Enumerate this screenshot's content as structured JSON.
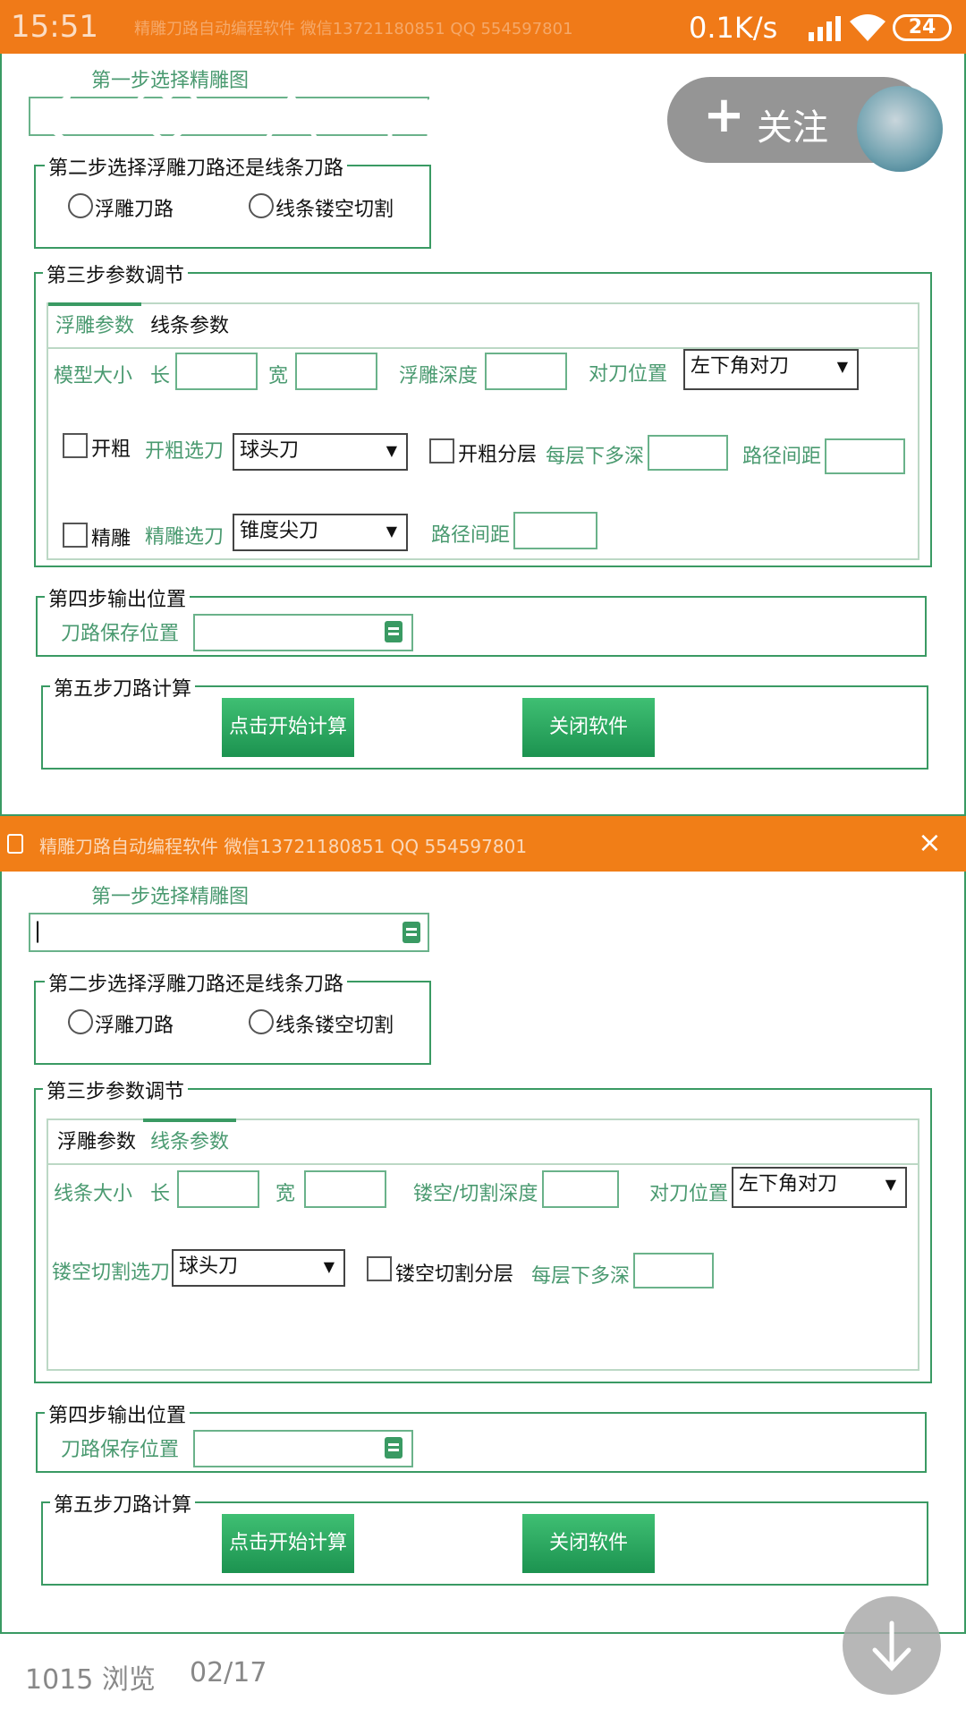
{
  "status": {
    "time": "15:51",
    "net_speed": "0.1K/s",
    "battery": "24",
    "blurred_title": "精雕刀路自动编程软件 微信13721180851 QQ 554597801"
  },
  "overlay": {
    "follow_label": "关注",
    "follow_plus": "+"
  },
  "window1": {
    "step1": "第一步选择精雕图",
    "step2": "第二步选择浮雕刀路还是线条刀路",
    "radio_relief": "浮雕刀路",
    "radio_line": "线条镂空切割",
    "step3": "第三步参数调节",
    "tab_relief": "浮雕参数",
    "tab_line": "线条参数",
    "model_size": "模型大小",
    "len": "长",
    "wid": "宽",
    "relief_depth": "浮雕深度",
    "tool_pos": "对刀位置",
    "tool_pos_value": "左下角对刀",
    "rough": "开粗",
    "rough_tool": "开粗选刀",
    "rough_tool_value": "球头刀",
    "rough_layer": "开粗分层",
    "per_layer": "每层下多深",
    "path_spacing": "路径间距",
    "finish": "精雕",
    "finish_tool": "精雕选刀",
    "finish_tool_value": "锥度尖刀",
    "finish_spacing": "路径间距",
    "step4": "第四步输出位置",
    "save_path": "刀路保存位置",
    "step5": "第五步刀路计算",
    "calc_btn": "点击开始计算",
    "close_btn": "关闭软件"
  },
  "window2": {
    "title": "精雕刀路自动编程软件 微信13721180851 QQ 554597801",
    "close": "×",
    "step1": "第一步选择精雕图",
    "file_value": "|",
    "step2": "第二步选择浮雕刀路还是线条刀路",
    "radio_relief": "浮雕刀路",
    "radio_line": "线条镂空切割",
    "step3": "第三步参数调节",
    "tab_relief": "浮雕参数",
    "tab_line": "线条参数",
    "line_size": "线条大小",
    "len": "长",
    "wid": "宽",
    "cut_depth": "镂空/切割深度",
    "tool_pos": "对刀位置",
    "tool_pos_value": "左下角对刀",
    "cut_tool": "镂空切割选刀",
    "cut_tool_value": "球头刀",
    "cut_layer": "镂空切割分层",
    "per_layer": "每层下多深",
    "step4": "第四步输出位置",
    "save_path": "刀路保存位置",
    "step5": "第五步刀路计算",
    "calc_btn": "点击开始计算",
    "close_btn": "关闭软件"
  },
  "footer": {
    "views": "1015 浏览",
    "page": "02/17"
  }
}
